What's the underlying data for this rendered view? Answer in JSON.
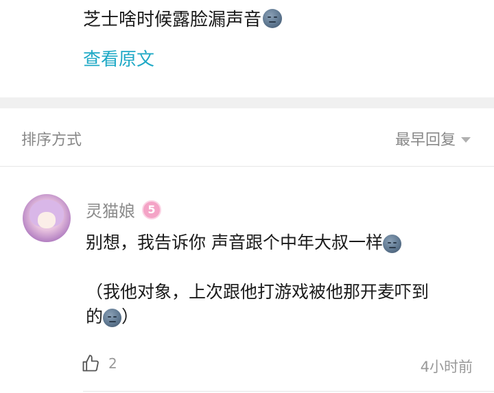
{
  "original": {
    "text": "芝士啥时候露脸漏声音",
    "emoji": "moon-face",
    "view_original": "查看原文"
  },
  "sort": {
    "label": "排序方式",
    "selected": "最早回复"
  },
  "comment": {
    "username": "灵猫娘",
    "level": "5",
    "line1": "别想，我告诉你 声音跟个中年大叔一样",
    "line2": "（我他对象，上次跟他打游戏被他那开麦吓到",
    "line3_start": "的",
    "line3_end": "）",
    "likes": "2",
    "time": "4小时前"
  },
  "colors": {
    "link": "#1fa9c6",
    "muted": "#888888",
    "separator": "#f0f0f0",
    "level_badge": "#f4a3c6"
  }
}
